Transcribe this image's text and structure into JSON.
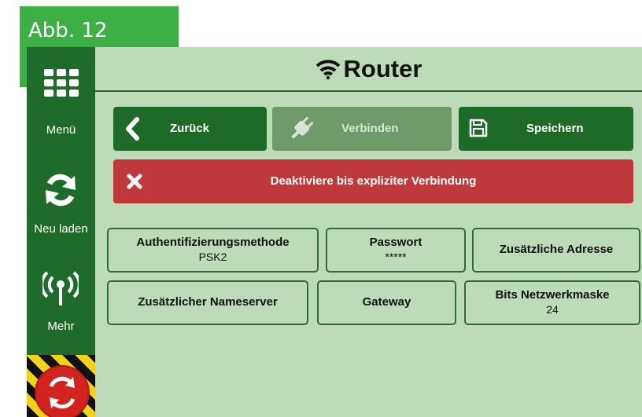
{
  "figure_label": "Abb. 12",
  "header": {
    "title": "Router"
  },
  "sidebar": {
    "items": [
      {
        "label": "Menü",
        "icon": "grid-menu-icon"
      },
      {
        "label": "Neu laden",
        "icon": "refresh-icon"
      },
      {
        "label": "Mehr",
        "icon": "antenna-icon"
      }
    ],
    "emergency_icon": "emergency-stop-icon"
  },
  "toolbar": {
    "back_label": "Zurück",
    "connect_label": "Verbinden",
    "save_label": "Speichern"
  },
  "alert": {
    "text": "Deaktiviere bis expliziter Verbindung",
    "icon": "close-icon",
    "color": "#c0393a"
  },
  "fields": [
    {
      "label": "Authentifizierungsmethode",
      "value": "PSK2"
    },
    {
      "label": "Passwort",
      "value": "*****"
    },
    {
      "label": "Zusätzliche Adresse",
      "value": ""
    },
    {
      "label": "Zusätzlicher Nameserver",
      "value": ""
    },
    {
      "label": "Gateway",
      "value": ""
    },
    {
      "label": "Bits Netzwerkmaske",
      "value": "24"
    }
  ],
  "colors": {
    "accent": "#1e6b28",
    "background": "#bddab9",
    "sidebar": "#1f6b2a",
    "figure_tag": "#3db045"
  }
}
